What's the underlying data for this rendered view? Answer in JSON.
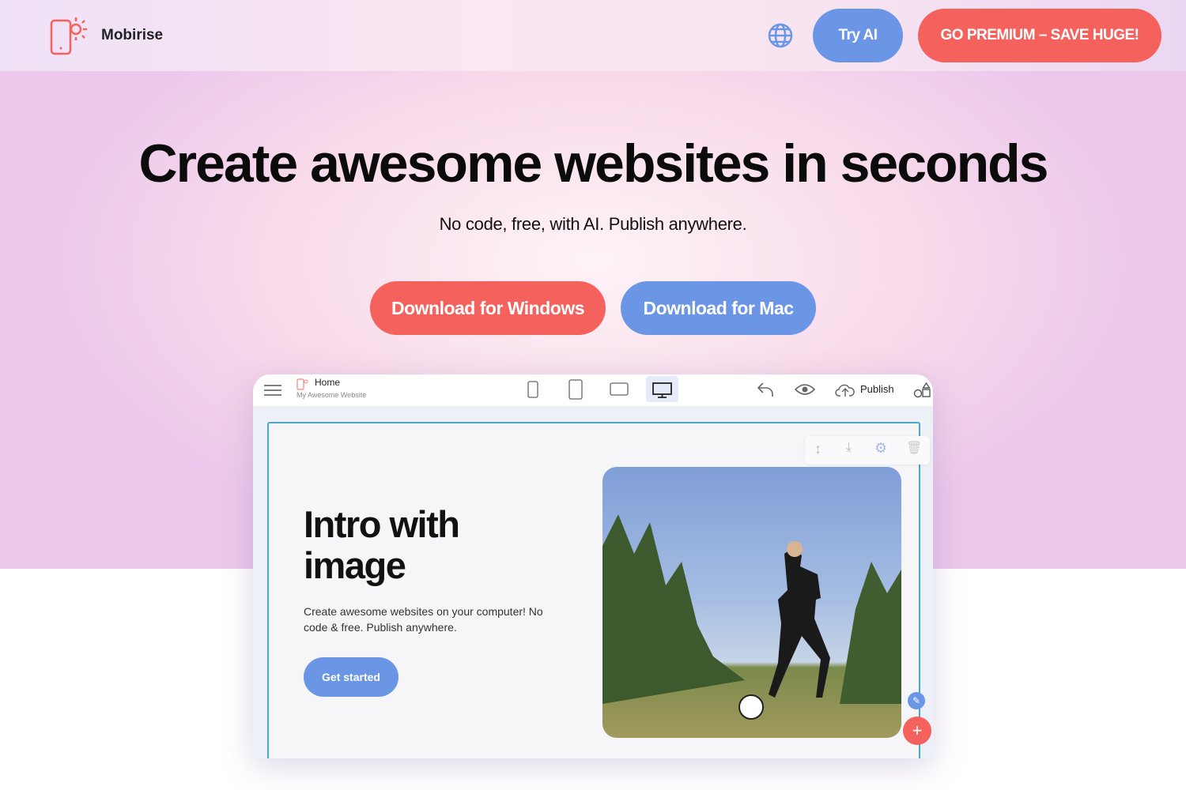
{
  "nav": {
    "brand": "Mobirise",
    "try_ai": "Try AI",
    "premium": "GO PREMIUM – SAVE HUGE!"
  },
  "hero": {
    "title": "Create awesome websites in seconds",
    "subtitle": "No code, free, with AI. Publish anywhere.",
    "download_windows": "Download for Windows",
    "download_mac": "Download for Mac"
  },
  "app": {
    "page_name": "Home",
    "site_name": "My Awesome Website",
    "publish": "Publish",
    "block": {
      "title_line1": "Intro with",
      "title_line2": "image",
      "description": "Create awesome websites on your computer! No code & free. Publish anywhere.",
      "button": "Get started"
    }
  },
  "colors": {
    "accent_red": "#f5625e",
    "accent_blue": "#6b96e6",
    "frame": "#4aa8c6"
  }
}
